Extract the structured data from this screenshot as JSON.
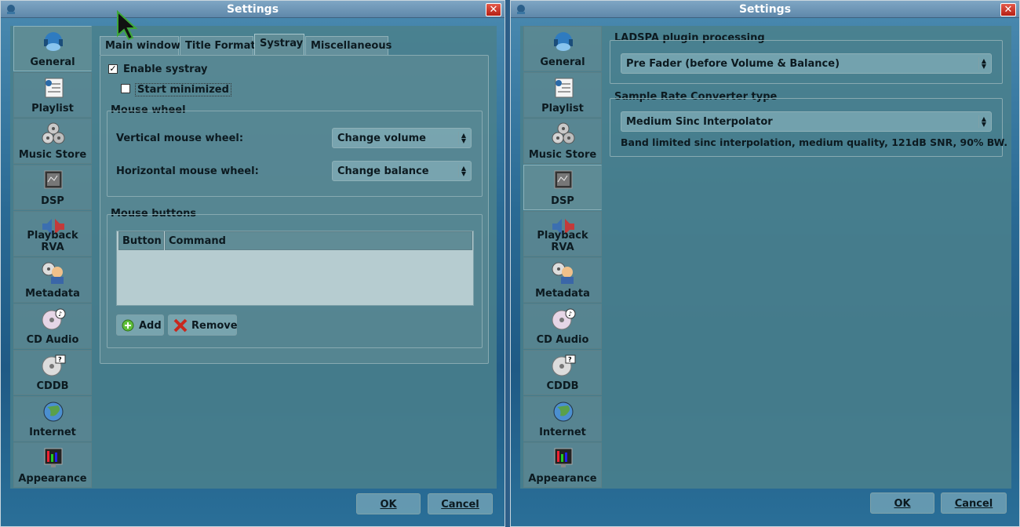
{
  "left_window": {
    "title": "Settings",
    "close_glyph": "✕",
    "sidebar": [
      {
        "label": "General",
        "icon": "general-icon"
      },
      {
        "label": "Playlist",
        "icon": "playlist-icon"
      },
      {
        "label": "Music Store",
        "icon": "music-store-icon"
      },
      {
        "label": "DSP",
        "icon": "dsp-icon"
      },
      {
        "label": "Playback RVA",
        "icon": "playback-rva-icon"
      },
      {
        "label": "Metadata",
        "icon": "metadata-icon"
      },
      {
        "label": "CD Audio",
        "icon": "cd-audio-icon"
      },
      {
        "label": "CDDB",
        "icon": "cddb-icon"
      },
      {
        "label": "Internet",
        "icon": "internet-icon"
      },
      {
        "label": "Appearance",
        "icon": "appearance-icon"
      }
    ],
    "active_item": "General",
    "tabs": [
      "Main window",
      "Title Format",
      "Systray",
      "Miscellaneous"
    ],
    "active_tab": "Systray",
    "enable_systray": {
      "label": "Enable systray",
      "checked": true,
      "mark": "✓"
    },
    "start_minimized": {
      "label": "Start minimized",
      "checked": false
    },
    "mouse_wheel": {
      "title": "Mouse wheel",
      "vertical_label": "Vertical mouse wheel:",
      "vertical_value": "Change volume",
      "horizontal_label": "Horizontal mouse wheel:",
      "horizontal_value": "Change balance"
    },
    "mouse_buttons": {
      "title": "Mouse buttons",
      "columns": [
        "Button",
        "Command"
      ],
      "rows": [],
      "add_label": "Add",
      "remove_label": "Remove"
    },
    "ok_label": "OK",
    "cancel_label": "Cancel"
  },
  "right_window": {
    "title": "Settings",
    "close_glyph": "✕",
    "active_item": "DSP",
    "ladspa": {
      "title": "LADSPA plugin processing",
      "value": "Pre Fader (before Volume & Balance)"
    },
    "src": {
      "title": "Sample Rate Converter type",
      "value": "Medium Sinc Interpolator",
      "description": "Band limited sinc interpolation, medium quality, 121dB SNR, 90% BW."
    },
    "ok_label": "OK",
    "cancel_label": "Cancel"
  },
  "colors": {
    "accent": "#5f88aa",
    "panel": "#4a808c",
    "close": "#c4281c"
  }
}
